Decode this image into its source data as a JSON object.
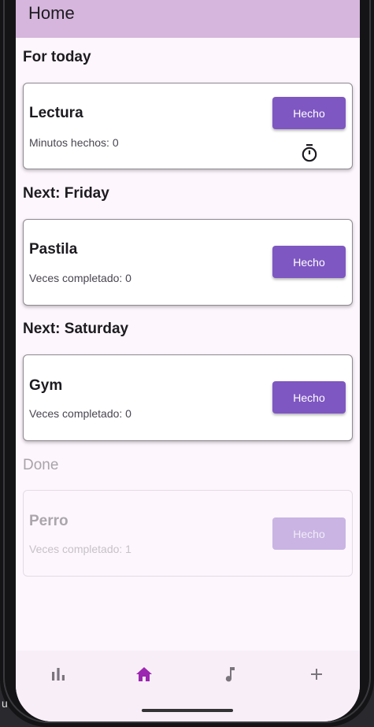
{
  "appbar": {
    "title": "Home"
  },
  "sections": {
    "today": "For today",
    "friday": "Next: Friday",
    "saturday": "Next: Saturday",
    "done": "Done"
  },
  "cards": [
    {
      "title": "Lectura",
      "subtitle": "Minutos hechos: 0",
      "button": "Hecho"
    },
    {
      "title": "Pastila",
      "subtitle": "Veces completado: 0",
      "button": "Hecho"
    },
    {
      "title": "Gym",
      "subtitle": "Veces completado: 0",
      "button": "Hecho"
    },
    {
      "title": "Perro",
      "subtitle": "Veces completado: 1",
      "button": "Hecho"
    }
  ],
  "nav": {
    "items": [
      {
        "icon": "bar-chart-icon",
        "selected": false
      },
      {
        "icon": "home-icon",
        "selected": true
      },
      {
        "icon": "music-note-icon",
        "selected": false
      },
      {
        "icon": "add-icon",
        "selected": false
      }
    ]
  },
  "side_text": "u",
  "colors": {
    "appbar": "#d6b6dd",
    "background": "#fdf6fd",
    "button": "#7e57c2",
    "nav_selected": "#9c27b0",
    "nav_unselected": "#7a747c"
  }
}
